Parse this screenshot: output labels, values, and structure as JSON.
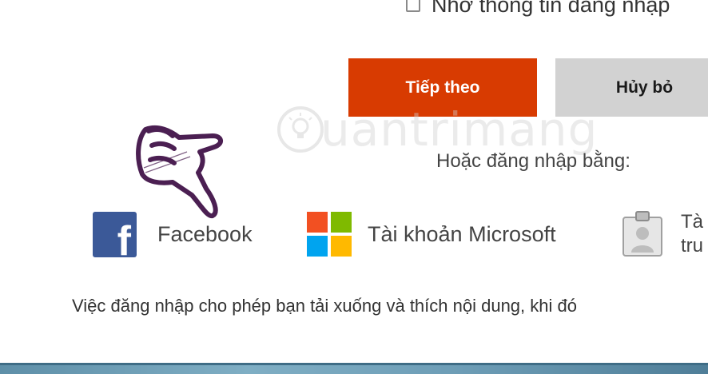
{
  "remember": {
    "label": "Nhớ thông tin đăng nhập",
    "checked": false
  },
  "buttons": {
    "next_label": "Tiếp theo",
    "cancel_label": "Hủy bỏ"
  },
  "watermark": {
    "text": "uantrimang"
  },
  "or_label": "Hoặc đăng nhập bằng:",
  "providers": [
    {
      "label": "Facebook",
      "icon": "facebook-icon"
    },
    {
      "label": "Tài khoản Microsoft",
      "icon": "microsoft-icon"
    },
    {
      "label_line1": "Tà",
      "label_line2": "tru",
      "icon": "profile-card-icon"
    }
  ],
  "info_text": "Việc đăng nhập cho phép bạn tải xuống và thích nội dung, khi đó",
  "colors": {
    "primary_button": "#d83b01",
    "secondary_button": "#d2d2d2",
    "facebook": "#3b5998",
    "ms_red": "#f25022",
    "ms_green": "#7fba00",
    "ms_blue": "#00a4ef",
    "ms_yellow": "#ffb900"
  }
}
